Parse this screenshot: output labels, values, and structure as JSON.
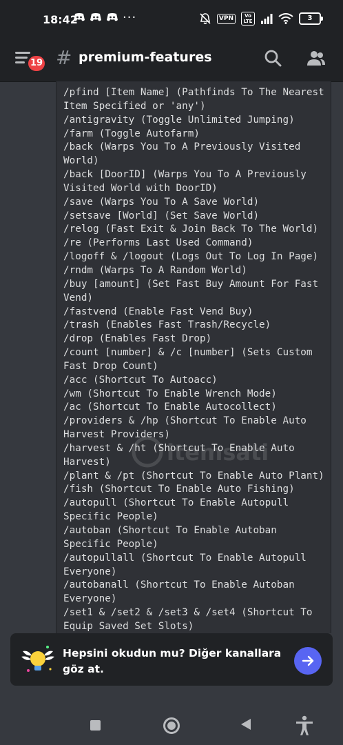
{
  "status_bar": {
    "time": "18:42",
    "more": "···",
    "vpn": "VPN",
    "volte": "Vo LTE",
    "battery": "3"
  },
  "header": {
    "channel_name": "premium-features",
    "mention_count": "19"
  },
  "message": {
    "lines": [
      "/pfind [Item Name] (Pathfinds To The Nearest",
      "Item Specified or 'any')",
      "/antigravity (Toggle Unlimited Jumping)",
      "/farm (Toggle Autofarm)",
      "/back (Warps You To A Previously Visited",
      "World)",
      "/back [DoorID] (Warps You To A Previously",
      "Visited World with DoorID)",
      "/save (Warps You To A Save World)",
      "/setsave [World] (Set Save World)",
      "/relog (Fast Exit & Join Back To The World)",
      "/re (Performs Last Used Command)",
      "/logoff & /logout (Logs Out To Log In Page)",
      "/rndm (Warps To A Random World)",
      "/buy [amount] (Set Fast Buy Amount For Fast",
      "Vend)",
      "/fastvend (Enable Fast Vend Buy)",
      "/trash (Enables Fast Trash/Recycle)",
      "/drop (Enables Fast Drop)",
      "/count [number] & /c [number] (Sets Custom",
      "Fast Drop Count)",
      "/acc (Shortcut To Autoacc)",
      "/wm (Shortcut To Enable Wrench Mode)",
      "/ac (Shortcut To Enable Autocollect)",
      "/providers & /hp (Shortcut To Enable Auto",
      "Harvest Providers)",
      "/harvest & /ht (Shortcut To Enable Auto",
      "Harvest)",
      "/plant & /pt (Shortcut To Enable Auto Plant)",
      "/fish (Shortcut To Enable Auto Fishing)",
      "/autopull (Shortcut To Enable Autopull",
      "Specific People)",
      "/autoban (Shortcut To Enable Autoban",
      "Specific People)",
      "/autopullall (Shortcut To Enable Autopull",
      "Everyone)",
      "/autobanall (Shortcut To Enable Autoban",
      "Everyone)",
      "/set1 & /set2 & /set3 & /set4 (Shortcut To",
      "Equip Saved Set Slots)"
    ]
  },
  "watermark": {
    "text": "itemsatis"
  },
  "notice": {
    "text": "Hepsini okudun mu? Diğer kanallara göz at."
  },
  "colors": {
    "background": "#36393f",
    "header": "#202225",
    "code_block": "#2f3136",
    "accent": "#5865f2",
    "mention_badge": "#ed4245"
  },
  "icons": {
    "menu": "hamburger-menu-icon",
    "hash": "hash-icon",
    "search": "search-icon",
    "members": "members-icon",
    "notice": "winged-lightbulb-icon",
    "go": "arrow-right-icon"
  }
}
